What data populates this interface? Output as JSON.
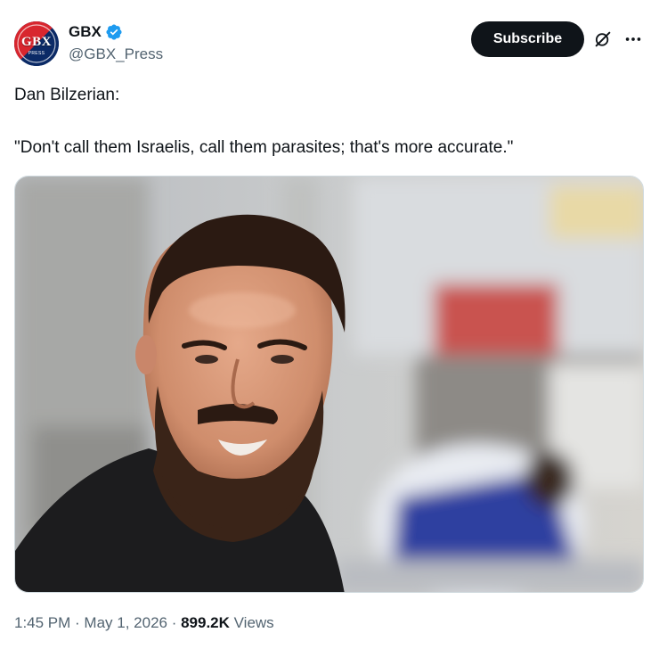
{
  "author": {
    "display_name": "GBX",
    "handle": "@GBX_Press",
    "avatar_text": "GBX",
    "avatar_subtext": "PRESS",
    "verified": true,
    "verified_color": "#1d9bf0"
  },
  "actions": {
    "subscribe_label": "Subscribe",
    "grok_icon": "grok-icon",
    "more_icon": "more-horizontal-icon"
  },
  "post": {
    "line1": "Dan Bilzerian:",
    "line2": "\"Don't call them Israelis, call them parasites; that's more accurate.\""
  },
  "media": {
    "type": "photo",
    "subject": "photo-bearded-man"
  },
  "meta": {
    "time": "1:45 PM",
    "separator": " · ",
    "date": "May 1, 2026",
    "views_count": "899.2K",
    "views_label": " Views"
  },
  "colors": {
    "text_primary": "#0f1419",
    "text_secondary": "#536471",
    "button_bg": "#0f1419",
    "border": "#cfd9de"
  }
}
